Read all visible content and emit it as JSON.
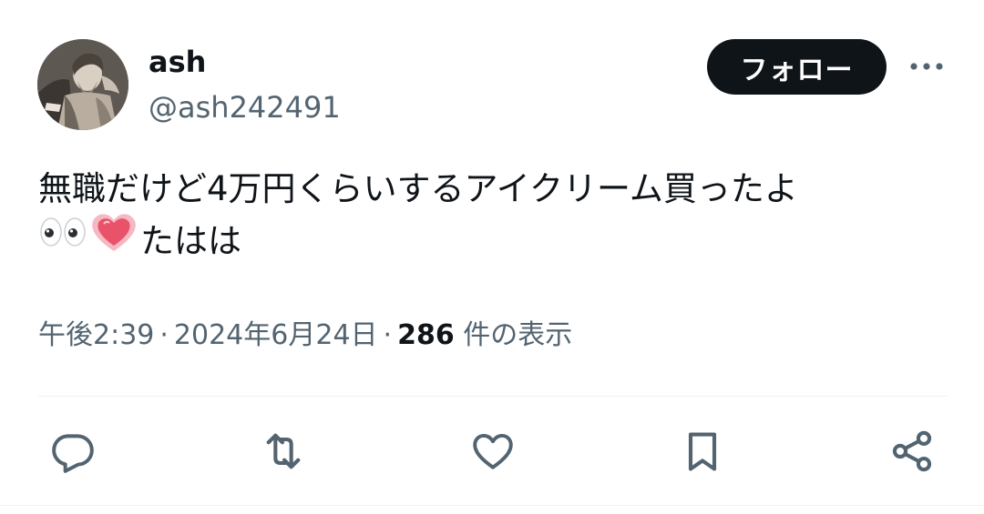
{
  "author": {
    "name": "ash",
    "handle": "@ash242491",
    "avatar_icon": "engraving-portrait-avatar"
  },
  "follow_button": {
    "label": "フォロー"
  },
  "more_button": {
    "icon": "more-horizontal-icon"
  },
  "tweet": {
    "line1": "無職だけど4万円くらいするアイクリーム買ったよ",
    "line2_text": "たはは",
    "emojis": [
      "eyes-emoji",
      "growing-heart-emoji"
    ]
  },
  "meta": {
    "time": "午後2:39",
    "separator": "·",
    "date": "2024年6月24日",
    "views_count": "286",
    "views_label": "件の表示"
  },
  "actions": [
    {
      "name": "reply",
      "icon": "reply-icon"
    },
    {
      "name": "retweet",
      "icon": "retweet-icon"
    },
    {
      "name": "like",
      "icon": "heart-icon"
    },
    {
      "name": "bookmark",
      "icon": "bookmark-icon"
    },
    {
      "name": "share",
      "icon": "share-icon"
    }
  ],
  "colors": {
    "text_primary": "#0f1419",
    "text_secondary": "#536471",
    "button_bg": "#0f1419",
    "divider": "#eff3f4",
    "heart_emoji": "#e8536a"
  }
}
